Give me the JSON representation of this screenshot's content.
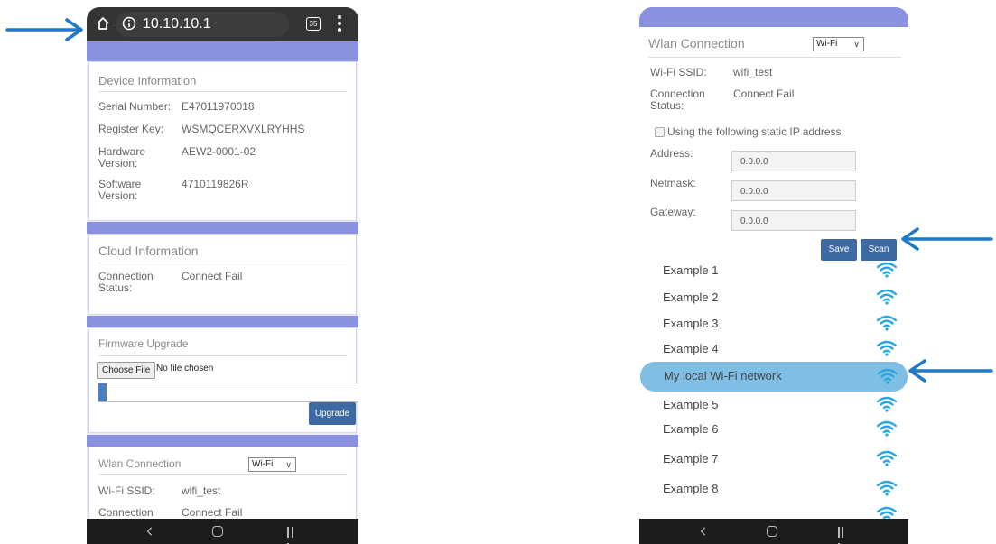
{
  "browser": {
    "url": "10.10.10.1",
    "tab_count": "35"
  },
  "device_info": {
    "title": "Device Information",
    "rows": [
      {
        "label": "Serial Number:",
        "value": "E47011970018"
      },
      {
        "label": "Register Key:",
        "value": "WSMQCERXVXLRYHHS"
      },
      {
        "label": "Hardware Version:",
        "value": "AEW2-0001-02"
      },
      {
        "label": "Software Version:",
        "value": "4710119826R"
      }
    ]
  },
  "cloud_info": {
    "title": "Cloud Information",
    "connection_label": "Connection Status:",
    "connection_value": "Connect Fail"
  },
  "firmware": {
    "title": "Firmware Upgrade",
    "choose_file": "Choose File",
    "no_file": "No file chosen",
    "progress": 0.03,
    "upgrade_button": "Upgrade"
  },
  "wlan_left": {
    "title": "Wlan Connection",
    "mode": "Wi-Fi",
    "ssid_label": "Wi-Fi SSID:",
    "ssid_value": "wifi_test",
    "connection_label": "Connection",
    "connection_value": "Connect Fail"
  },
  "wlan_right": {
    "title": "Wlan Connection",
    "mode": "Wi-Fi",
    "ssid_label": "Wi-Fi SSID:",
    "ssid_value": "wifi_test",
    "connection_label": "Connection Status:",
    "connection_value": "Connect Fail",
    "static_ip_label": "Using the following static IP address",
    "address_label": "Address:",
    "address_value": "0.0.0.0",
    "netmask_label": "Netmask:",
    "netmask_value": "0.0.0.0",
    "gateway_label": "Gateway:",
    "gateway_value": "0.0.0.0",
    "save_button": "Save",
    "scan_button": "Scan"
  },
  "networks": [
    {
      "name": "Example 1"
    },
    {
      "name": "Example 2"
    },
    {
      "name": "Example 3"
    },
    {
      "name": "Example 4"
    },
    {
      "name": "My local Wi-Fi network"
    },
    {
      "name": "Example 5"
    },
    {
      "name": "Example 6"
    },
    {
      "name": "Example 7"
    },
    {
      "name": "Example 8"
    },
    {
      "name": ""
    }
  ],
  "colors": {
    "arrow": "#1f78c8",
    "band": "#8a91df",
    "button": "#3e6aa3",
    "wifi_icon": "#27a7e1",
    "selected_row": "#7fbfe6"
  }
}
